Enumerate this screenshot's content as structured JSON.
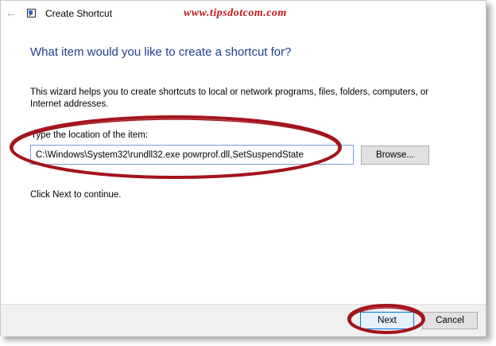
{
  "window": {
    "title": "Create Shortcut",
    "watermark": "www.tipsdotcom.com"
  },
  "main": {
    "heading": "What item would you like to create a shortcut for?",
    "description": "This wizard helps you to create shortcuts to local or network programs, files, folders, computers, or Internet addresses.",
    "field_label": "Type the location of the item:",
    "location_value": "C:\\Windows\\System32\\rundll32.exe powrprof.dll,SetSuspendState",
    "browse_label": "Browse...",
    "hint": "Click Next to continue."
  },
  "footer": {
    "next_label": "Next",
    "cancel_label": "Cancel"
  },
  "colors": {
    "heading": "#1f3f8f",
    "annotation_red": "#a4141b",
    "focus_blue": "#0078d7"
  },
  "icons": {
    "back": "back-arrow-icon",
    "app": "shortcut-app-icon"
  }
}
